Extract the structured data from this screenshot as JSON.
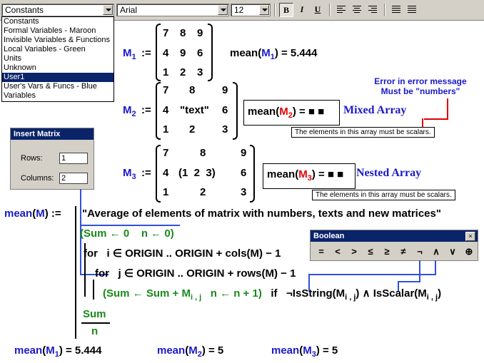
{
  "toolbar": {
    "style_value": "Constants",
    "font_value": "Arial",
    "size_value": "12",
    "bold_label": "B",
    "italic_label": "I",
    "underline_label": "U"
  },
  "style_list": {
    "options": [
      "Constants",
      "Formal Variables - Maroon",
      "Invisible Variables & Functions",
      "Local Variables - Green",
      "Units",
      "Unknown",
      "User1",
      "User's Vars & Funcs - Blue",
      "Variables"
    ],
    "selected": "User1"
  },
  "doc": {
    "assign": ":=",
    "M": "M",
    "mean": "mean",
    "eq": "=",
    "m1_sub": "1",
    "m2_sub": "2",
    "m3_sub": "3",
    "m1_rows": [
      [
        "7",
        "8",
        "9"
      ],
      [
        "4",
        "9",
        "6"
      ],
      [
        "1",
        "2",
        "3"
      ]
    ],
    "m2_rows": [
      [
        "7",
        "8",
        "9"
      ],
      [
        "4",
        "\"text\"",
        "6"
      ],
      [
        "1",
        "2",
        "3"
      ]
    ],
    "m3_rows": [
      [
        "7",
        "8",
        "9"
      ],
      [
        "4",
        "(1  2  3)",
        "6"
      ],
      [
        "1",
        "2",
        "3"
      ]
    ],
    "mean_m1_value": "5.444",
    "placeholder": "■ ■",
    "mixed_label": "Mixed Array",
    "nested_label": "Nested Array",
    "scalar_error": "The elements in this array must be scalars.",
    "error_note_line1": "Error in error message",
    "error_note_line2": "Must be \"numbers\"",
    "func_comment": "\"Average of elements of matrix with numbers, texts and new matrices\"",
    "line1": "Sum ← 0    n ← 0",
    "line2_for": "for",
    "line2_rest": "i ∈ ORIGIN .. ORIGIN + cols(M) − 1",
    "line3_for": "for",
    "line3_rest": "j ∈ ORIGIN .. ORIGIN + rows(M) − 1",
    "line4_sum": "Sum ← Sum + M",
    "line4_idx": "i , j",
    "line4_n": "n ← n + 1",
    "line4_if": "if",
    "line4_cond_a": "¬IsString(M",
    "line4_cond_b": ") ∧ IsScalar(M",
    "result_num": "Sum",
    "result_den": "n",
    "bottom_mean1_value": "5.444",
    "bottom_mean2_value": "5",
    "bottom_mean3_value": "5"
  },
  "insert_matrix": {
    "title": "Insert Matrix",
    "rows_label": "Rows:",
    "rows_value": "1",
    "columns_label": "Columns:",
    "columns_value": "2"
  },
  "boolean_toolbar": {
    "title": "Boolean",
    "close": "×",
    "ops": [
      "=",
      "<",
      ">",
      "≤",
      "≥",
      "≠",
      "¬",
      "∧",
      "∨",
      "⊕"
    ]
  }
}
